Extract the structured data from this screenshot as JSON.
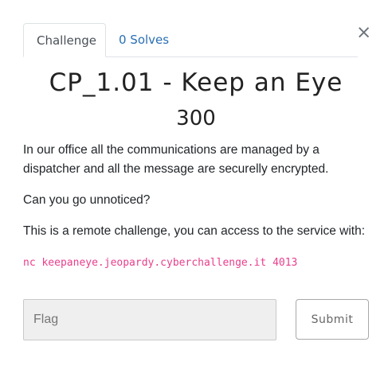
{
  "tabs": {
    "challenge_label": "Challenge",
    "solves_label": "0 Solves"
  },
  "close_label": "×",
  "challenge": {
    "title": "CP_1.01 - Keep an Eye",
    "points": "300",
    "description": [
      "In our office all the communications are managed by a dispatcher and all the message are securelly encrypted.",
      "Can you go unnoticed?",
      "This is a remote challenge, you can access to the service with:"
    ],
    "command": "nc keepaneye.jeopardy.cyberchallenge.it 4013"
  },
  "form": {
    "flag_placeholder": "Flag",
    "flag_value": "",
    "submit_label": "Submit"
  }
}
